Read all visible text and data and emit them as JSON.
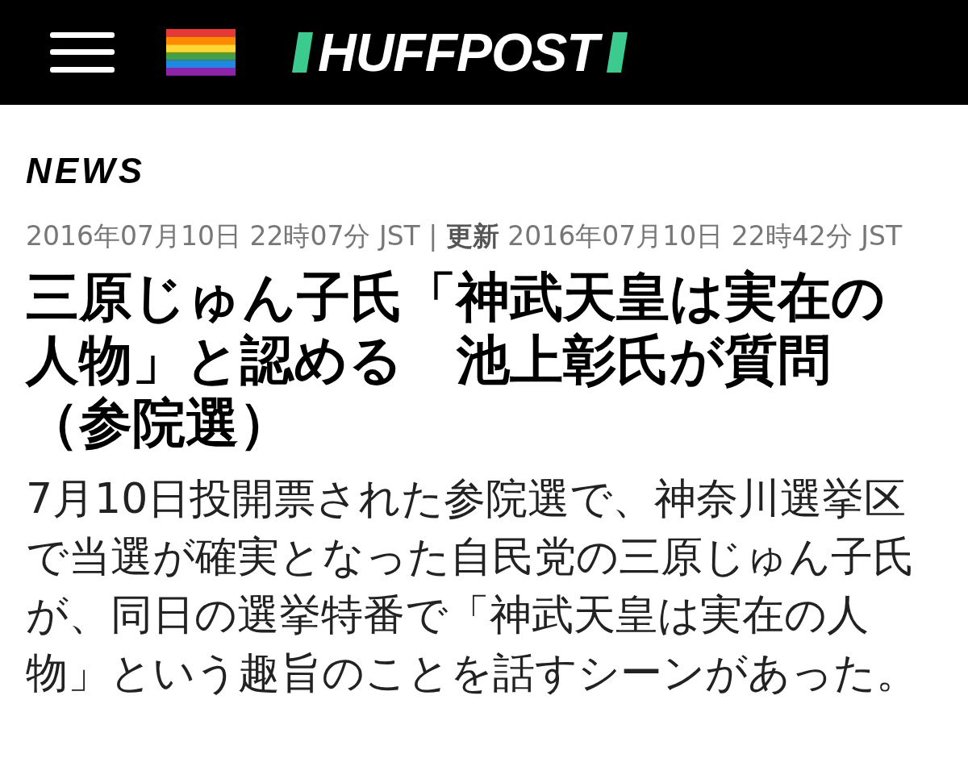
{
  "header": {
    "logo": "HUFFPOST"
  },
  "article": {
    "section": "NEWS",
    "dateline": "2016年07月10日 22時07分 JST | **更新** 2016年07月10日 22時42分 JST",
    "headline": "三原じゅん子氏「神武天皇は実在の人物」と認める　池上彰氏が質問（参院選）",
    "lead": "7月10日投開票された参院選で、神奈川選挙区で当選が確実となった自民党の三原じゅん子氏が、同日の選挙特番で「神武天皇は実在の人物」という趣旨のことを話すシーンがあった。"
  }
}
